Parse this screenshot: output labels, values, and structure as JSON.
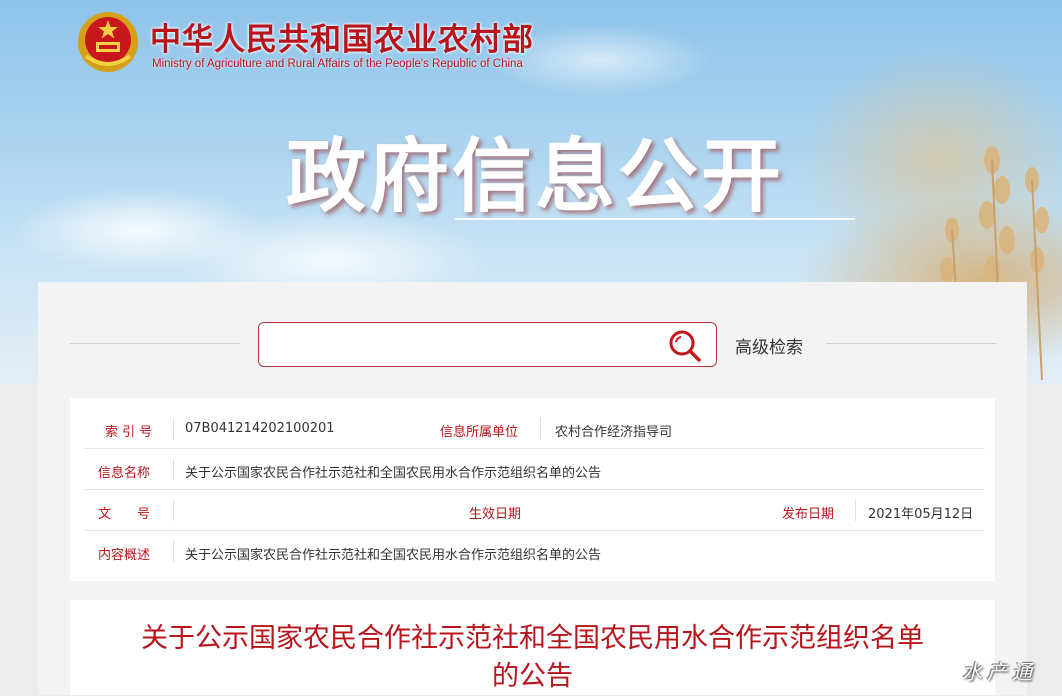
{
  "header": {
    "site_name": "中华人民共和国农业农村部",
    "site_name_en": "Ministry of Agriculture and Rural Affairs of the People's Republic of China",
    "section_title": "政府信息公开",
    "emblem_icon": "national-emblem-icon"
  },
  "search": {
    "placeholder": "",
    "value": "",
    "icon": "search-icon",
    "advanced_label": "高级检索"
  },
  "info": {
    "index_label": "索 引 号",
    "index_value": "07B041214202100201",
    "unit_label": "信息所属单位",
    "unit_value": "农村合作经济指导司",
    "name_label": "信息名称",
    "name_value": "关于公示国家农民合作社示范社和全国农民用水合作示范组织名单的公告",
    "doc_label": "文　　号",
    "effective_label": "生效日期",
    "publish_label": "发布日期",
    "publish_value": "2021年05月12日",
    "summary_label": "内容概述",
    "summary_value": "关于公示国家农民合作社示范社和全国农民用水合作示范组织名单的公告"
  },
  "article": {
    "title_line1": "关于公示国家农民合作社示范社和全国农民用水合作示范组织名单",
    "title_line2": "的公告"
  },
  "watermark": "水产通",
  "colors": {
    "accent": "#b8141b",
    "border": "#b43a3f"
  }
}
